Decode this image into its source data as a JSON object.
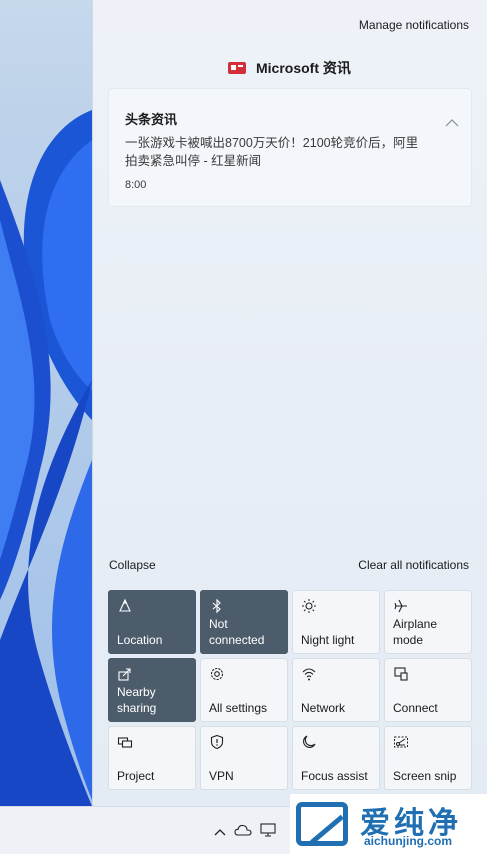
{
  "header": {
    "manage_notifications": "Manage notifications"
  },
  "notification_group": {
    "app_name": "Microsoft 资讯",
    "app_icon": "news-icon",
    "card": {
      "title": "头条资讯",
      "body": "一张游戏卡被喊出8700万天价！2100轮竞价后，阿里拍卖紧急叫停 - 红星新闻",
      "time": "8:00"
    }
  },
  "controls": {
    "collapse": "Collapse",
    "clear_all": "Clear all notifications"
  },
  "quick_actions": [
    {
      "label": "Location",
      "icon": "location-icon",
      "active": true
    },
    {
      "label": "Not connected",
      "icon": "bluetooth-icon",
      "active": true
    },
    {
      "label": "Night light",
      "icon": "night-light-icon",
      "active": false
    },
    {
      "label": "Airplane mode",
      "icon": "airplane-icon",
      "active": false
    },
    {
      "label": "Nearby sharing",
      "icon": "nearby-sharing-icon",
      "active": true
    },
    {
      "label": "All settings",
      "icon": "gear-icon",
      "active": false
    },
    {
      "label": "Network",
      "icon": "network-icon",
      "active": false
    },
    {
      "label": "Connect",
      "icon": "connect-icon",
      "active": false
    },
    {
      "label": "Project",
      "icon": "project-icon",
      "active": false
    },
    {
      "label": "VPN",
      "icon": "vpn-icon",
      "active": false
    },
    {
      "label": "Focus assist",
      "icon": "moon-icon",
      "active": false
    },
    {
      "label": "Screen snip",
      "icon": "scissors-icon",
      "active": false
    }
  ],
  "watermark": {
    "cn": "爱纯净",
    "url": "aichunjing.com"
  },
  "colors": {
    "active_tile": "#4d5c6b",
    "brand_red": "#d32f3a",
    "watermark_blue": "#1f6fb2"
  }
}
